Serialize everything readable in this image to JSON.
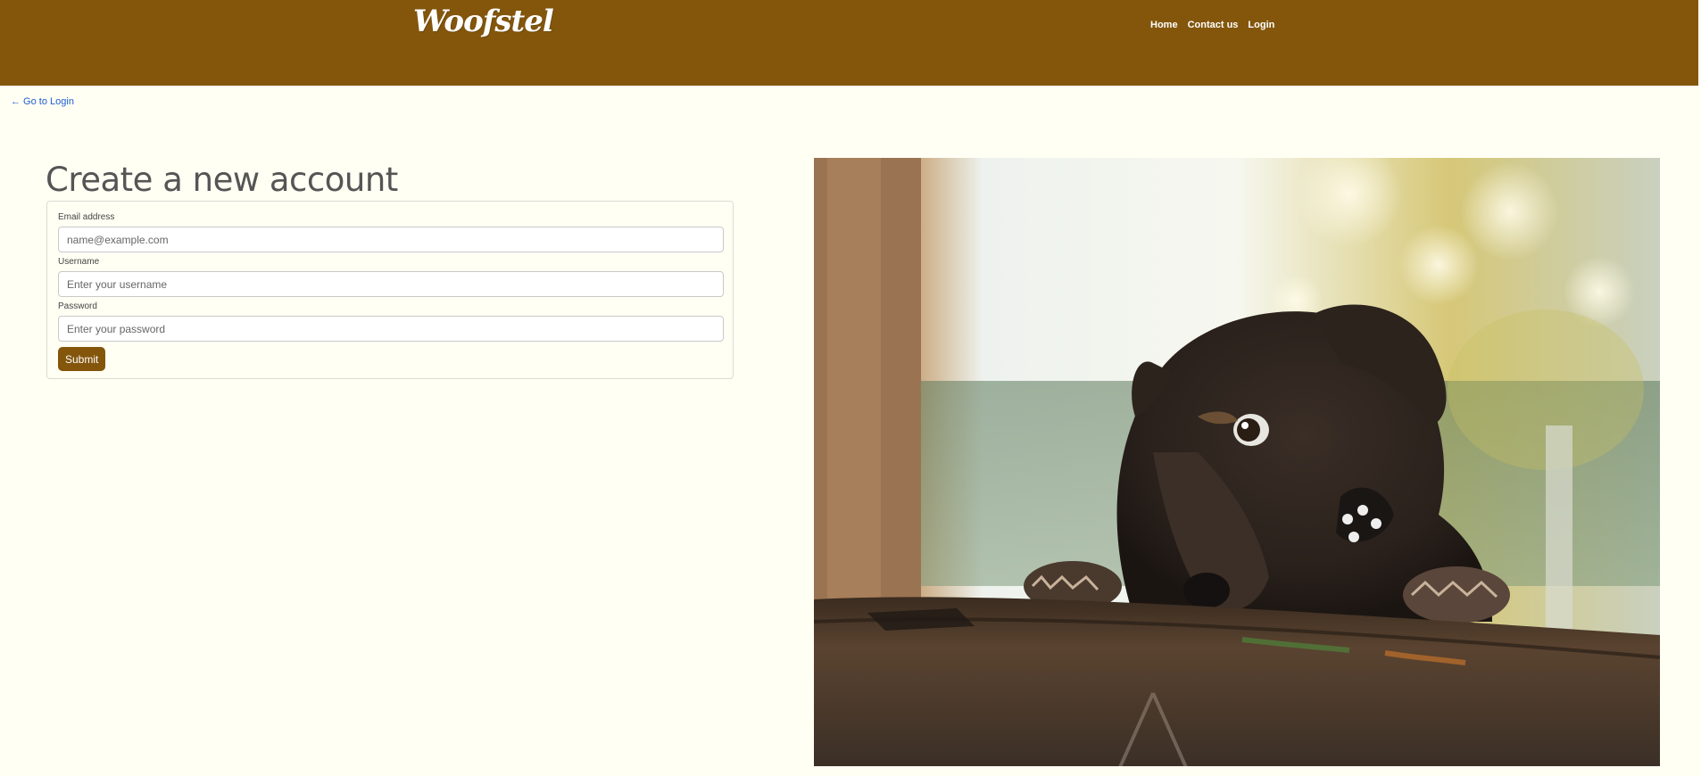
{
  "header": {
    "logo": "Woofstel",
    "nav": [
      {
        "label": "Home"
      },
      {
        "label": "Contact us"
      },
      {
        "label": "Login"
      }
    ]
  },
  "back_link": "← Go to Login",
  "form": {
    "title": "Create a new account",
    "email": {
      "label": "Email address",
      "placeholder": "name@example.com",
      "value": ""
    },
    "username": {
      "label": "Username",
      "placeholder": "Enter your username",
      "value": ""
    },
    "password": {
      "label": "Password",
      "placeholder": "Enter your password",
      "value": ""
    },
    "submit_label": "Submit"
  },
  "image": {
    "subject": "puppy-photo"
  },
  "colors": {
    "brand": "#83560c",
    "background": "#fffff4",
    "link": "#1f5fd0"
  }
}
